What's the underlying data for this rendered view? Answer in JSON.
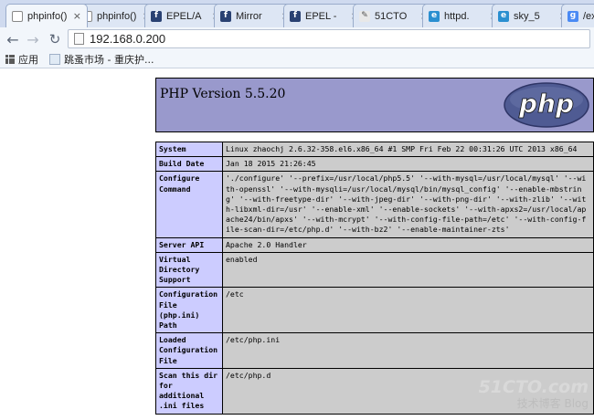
{
  "browser": {
    "tabs": [
      {
        "title": "phpinfo()",
        "icon": "page-icon",
        "active": true
      },
      {
        "title": "phpinfo()",
        "icon": "page-icon",
        "active": false
      },
      {
        "title": "EPEL/A",
        "icon": "fedora-icon",
        "active": false
      },
      {
        "title": "Mirror",
        "icon": "fedora-icon",
        "active": false
      },
      {
        "title": "EPEL -",
        "icon": "fedora-icon",
        "active": false
      },
      {
        "title": "51CTO",
        "icon": "tool-icon",
        "active": false
      },
      {
        "title": "httpd.",
        "icon": "web-icon",
        "active": false
      },
      {
        "title": "sky_5",
        "icon": "web-icon",
        "active": false
      },
      {
        "title": "/ext/s",
        "icon": "google-icon",
        "active": false
      }
    ],
    "close_glyph": "×",
    "url": "192.168.0.200",
    "bookmarks": [
      {
        "label": "应用",
        "icon": "apps-grid-icon"
      },
      {
        "label": "跳蚤市场 - 重庆护...",
        "icon": "bookmark-page-icon"
      }
    ]
  },
  "phpinfo": {
    "version": "PHP Version 5.5.20",
    "logo_text": "php",
    "rows": [
      {
        "label": "System",
        "value": "Linux zhaochj 2.6.32-358.el6.x86_64 #1 SMP Fri Feb 22 00:31:26 UTC 2013 x86_64"
      },
      {
        "label": "Build Date",
        "value": "Jan 18 2015 21:26:45"
      },
      {
        "label": "Configure Command",
        "value": "'./configure' '--prefix=/usr/local/php5.5' '--with-mysql=/usr/local/mysql' '--with-openssl' '--with-mysqli=/usr/local/mysql/bin/mysql_config' '--enable-mbstring' '--with-freetype-dir' '--with-jpeg-dir' '--with-png-dir' '--with-zlib' '--with-libxml-dir=/usr' '--enable-xml' '--enable-sockets' '--with-apxs2=/usr/local/apache24/bin/apxs' '--with-mcrypt' '--with-config-file-path=/etc' '--with-config-file-scan-dir=/etc/php.d' '--with-bz2' '--enable-maintainer-zts'"
      },
      {
        "label": "Server API",
        "value": "Apache 2.0 Handler"
      },
      {
        "label": "Virtual Directory Support",
        "value": "enabled"
      },
      {
        "label": "Configuration File (php.ini) Path",
        "value": "/etc"
      },
      {
        "label": "Loaded Configuration File",
        "value": "/etc/php.ini"
      },
      {
        "label": "Scan this dir for additional .ini files",
        "value": "/etc/php.d"
      }
    ]
  },
  "watermark": {
    "top": "51CTO.com",
    "bottom": "技术博客 Blog"
  },
  "colors": {
    "header_bg": "#9999cc",
    "label_bg": "#ccccff",
    "value_bg": "#cccccc",
    "logo": "#4f5b93"
  }
}
